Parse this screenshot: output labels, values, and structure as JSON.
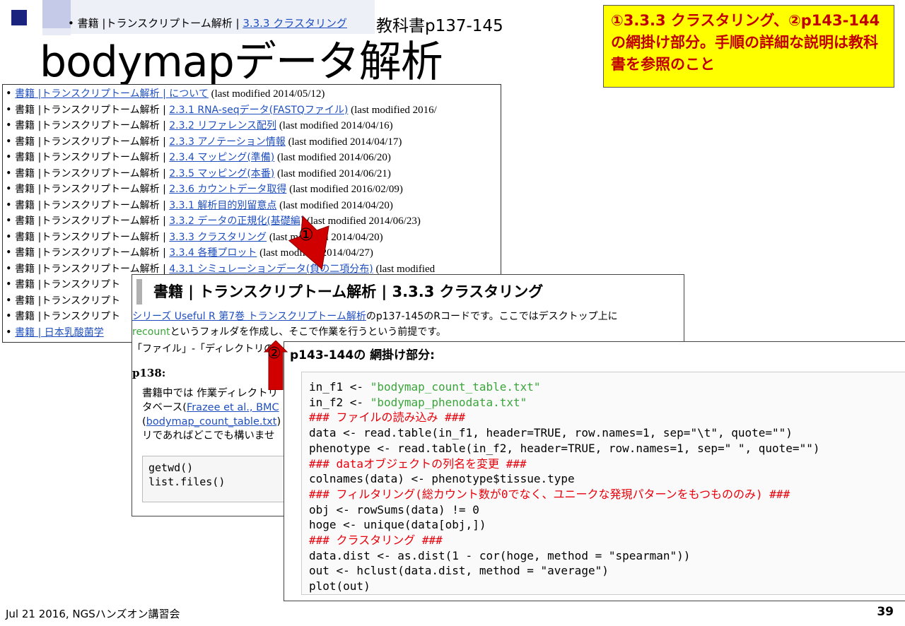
{
  "breadcrumb": {
    "bullet": "•",
    "prefix": "書籍 |トランスクリプトーム解析 | ",
    "link": "3.3.3 クラスタリング"
  },
  "page_ref": "教科書p137-145",
  "title": "bodymapデータ解析",
  "note": "①3.3.3 クラスタリング、②p143-144の網掛け部分。手順の詳細な説明は教科書を参照のこと",
  "list": {
    "rows": [
      {
        "prefix": "",
        "link": "書籍 |トランスクリプトーム解析 | について",
        "mod": " (last modified 2014/05/12)"
      },
      {
        "prefix": "書籍 |トランスクリプトーム解析 | ",
        "link": "2.3.1 RNA-seqデータ(FASTQファイル)",
        "mod": " (last modified 2016/"
      },
      {
        "prefix": "書籍 |トランスクリプトーム解析 | ",
        "link": "2.3.2 リファレンス配列",
        "mod": " (last modified 2014/04/16)"
      },
      {
        "prefix": "書籍 |トランスクリプトーム解析 | ",
        "link": "2.3.3 アノテーション情報",
        "mod": " (last modified 2014/04/17)"
      },
      {
        "prefix": "書籍 |トランスクリプトーム解析 | ",
        "link": "2.3.4 マッピング(準備)",
        "mod": " (last modified 2014/06/20)"
      },
      {
        "prefix": "書籍 |トランスクリプトーム解析 | ",
        "link": "2.3.5 マッピング(本番)",
        "mod": " (last modified 2014/06/21)"
      },
      {
        "prefix": "書籍 |トランスクリプトーム解析 | ",
        "link": "2.3.6 カウントデータ取得",
        "mod": " (last modified 2016/02/09)"
      },
      {
        "prefix": "書籍 |トランスクリプトーム解析 | ",
        "link": "3.3.1 解析目的別留意点",
        "mod": " (last modified 2014/04/20)"
      },
      {
        "prefix": "書籍 |トランスクリプトーム解析 | ",
        "link": "3.3.2 データの正規化(基礎編)",
        "mod": " (last modified 2014/06/23)"
      },
      {
        "prefix": "書籍 |トランスクリプトーム解析 | ",
        "link": "3.3.3 クラスタリング",
        "mod": " (last modified 2014/04/20)"
      },
      {
        "prefix": "書籍 |トランスクリプトーム解析 | ",
        "link": "3.3.4 各種プロット",
        "mod": " (last modified 2014/04/27)"
      },
      {
        "prefix": "書籍 |トランスクリプトーム解析 | ",
        "link": "4.3.1 シミュレーションデータ(負の二項分布)",
        "mod": " (last modified"
      },
      {
        "prefix": "書籍 |トランスクリプト",
        "link": "",
        "mod": ""
      },
      {
        "prefix": "書籍 |トランスクリプト",
        "link": "",
        "mod": ""
      },
      {
        "prefix": "書籍 |トランスクリプト",
        "link": "",
        "mod": ""
      },
      {
        "prefix": "",
        "link": "書籍 | 日本乳酸菌学",
        "mod": ""
      }
    ]
  },
  "window2": {
    "heading": "書籍 | トランスクリプトーム解析 | 3.3.3 クラスタリング",
    "intro_link": "シリーズ Useful R 第7巻 トランスクリプトーム解析",
    "intro_rest": "のp137-145のRコードです。ここではデスクトップ上に",
    "line2_link": "recount",
    "line2_rest": "というフォルダを作成し、そこで作業を行うという前提です。",
    "line3": "「ファイル」-「ディレクトリの",
    "p138": "p138:",
    "text1": "書籍中では 作業ディレクトリ",
    "text2_pre": "タベース(",
    "text2_link": "Frazee et al., BMC",
    "text3_pre": "(",
    "text3_link": "bodymap_count_table.txt",
    "text3_post": ")",
    "text4": "リであればどこでも構いませ",
    "code1": "getwd()",
    "code2": "list.files()"
  },
  "window3": {
    "heading": "p143-144の 網掛け部分:",
    "code_lines": [
      [
        {
          "t": "in_f1 <- ",
          "c": ""
        },
        {
          "t": "\"bodymap_count_table.txt\"",
          "c": "str"
        }
      ],
      [
        {
          "t": "in_f2 <- ",
          "c": ""
        },
        {
          "t": "\"bodymap_phenodata.txt\"",
          "c": "str"
        }
      ],
      [
        {
          "t": "### ファイルの読み込み ###",
          "c": "cm"
        }
      ],
      [
        {
          "t": "data <- read.table(in_f1, header=TRUE, row.names=1, sep=\"\\t\", quote=\"\")",
          "c": ""
        }
      ],
      [
        {
          "t": "phenotype <- read.table(in_f2, header=TRUE, row.names=1, sep=\" \", quote=\"\")",
          "c": ""
        }
      ],
      [
        {
          "t": "### dataオブジェクトの列名を変更 ###",
          "c": "cm"
        }
      ],
      [
        {
          "t": "colnames(data) <- phenotype$tissue.type",
          "c": ""
        }
      ],
      [
        {
          "t": "### フィルタリング(総カウント数が0でなく、ユニークな発現パターンをもつもののみ) ###",
          "c": "cm"
        }
      ],
      [
        {
          "t": "obj <- rowSums(data) != 0",
          "c": ""
        }
      ],
      [
        {
          "t": "hoge <- unique(data[obj,])",
          "c": ""
        }
      ],
      [
        {
          "t": "### クラスタリング ###",
          "c": "cm"
        }
      ],
      [
        {
          "t": "data.dist <- as.dist(1 - cor(hoge, method = \"spearman\"))",
          "c": ""
        }
      ],
      [
        {
          "t": "out <- hclust(data.dist, method = \"average\")",
          "c": ""
        }
      ],
      [
        {
          "t": "plot(out)",
          "c": ""
        }
      ]
    ]
  },
  "markers": {
    "one": "①",
    "two": "②"
  },
  "footer": "Jul 21 2016, NGSハンズオン講習会",
  "page_number": "39",
  "colors": {
    "note_bg": "#ffff00",
    "note_text": "#c00000",
    "link": "#1f4fbf",
    "comment": "#e8000b",
    "string": "#3aa53a",
    "arrow": "#d10000"
  }
}
